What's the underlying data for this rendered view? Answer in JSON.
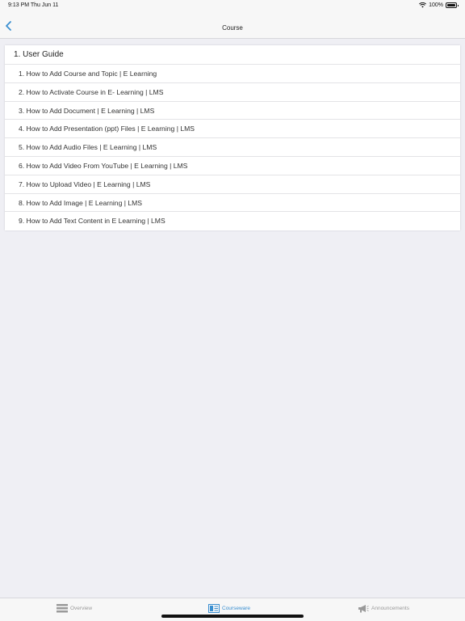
{
  "status_bar": {
    "time": "9:13 PM   Thu Jun 11",
    "battery": "100%"
  },
  "nav": {
    "title": "Course"
  },
  "section": {
    "title": "1. User Guide",
    "items": [
      "1. How to Add Course and Topic | E Learning",
      "2. How to Activate Course in E- Learning | LMS",
      "3. How to Add Document | E Learning | LMS",
      "4. How to Add Presentation (ppt) Files | E Learning | LMS",
      "5. How to Add Audio Files | E Learning | LMS",
      "6. How to Add Video From YouTube | E Learning | LMS",
      "7. How to Upload Video | E Learning | LMS",
      "8. How to Add Image | E Learning | LMS",
      "9. How to Add Text Content in E Learning | LMS"
    ]
  },
  "tabs": [
    {
      "label": "Overview",
      "icon": "overview-icon"
    },
    {
      "label": "Courseware",
      "icon": "courseware-icon"
    },
    {
      "label": "Announcements",
      "icon": "megaphone-icon"
    }
  ],
  "colors": {
    "accent": "#3a8fd0",
    "background": "#efeff4",
    "inactive_tab": "#9a9a9a"
  }
}
